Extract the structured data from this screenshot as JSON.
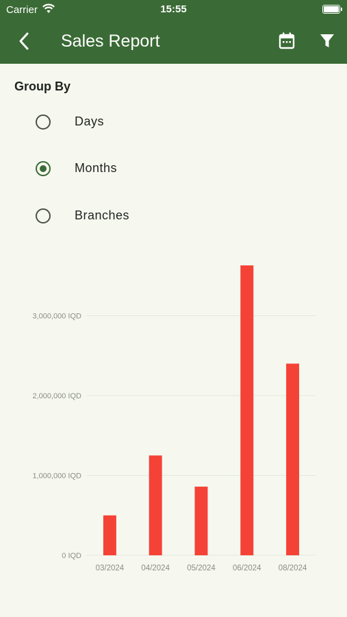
{
  "status_bar": {
    "carrier": "Carrier",
    "time": "15:55"
  },
  "header": {
    "title": "Sales Report",
    "back_icon": "chevron-left-icon",
    "calendar_icon": "calendar-icon",
    "filter_icon": "filter-icon"
  },
  "group_by": {
    "label": "Group By",
    "options": [
      {
        "label": "Days",
        "selected": false
      },
      {
        "label": "Months",
        "selected": true
      },
      {
        "label": "Branches",
        "selected": false
      }
    ]
  },
  "colors": {
    "appbar": "#3a6a35",
    "bar": "#f44336",
    "background": "#f6f8f0"
  },
  "chart_data": {
    "type": "bar",
    "categories": [
      "03/2024",
      "04/2024",
      "05/2024",
      "06/2024",
      "08/2024"
    ],
    "values": [
      500000,
      1250000,
      860000,
      3630000,
      2400000
    ],
    "y_ticks": [
      0,
      1000000,
      2000000,
      3000000
    ],
    "y_tick_labels": [
      "0 IQD",
      "1,000,000 IQD",
      "2,000,000 IQD",
      "3,000,000 IQD"
    ],
    "ylim": [
      0,
      3630000
    ],
    "grid": true,
    "title": "",
    "xlabel": "",
    "ylabel": ""
  }
}
